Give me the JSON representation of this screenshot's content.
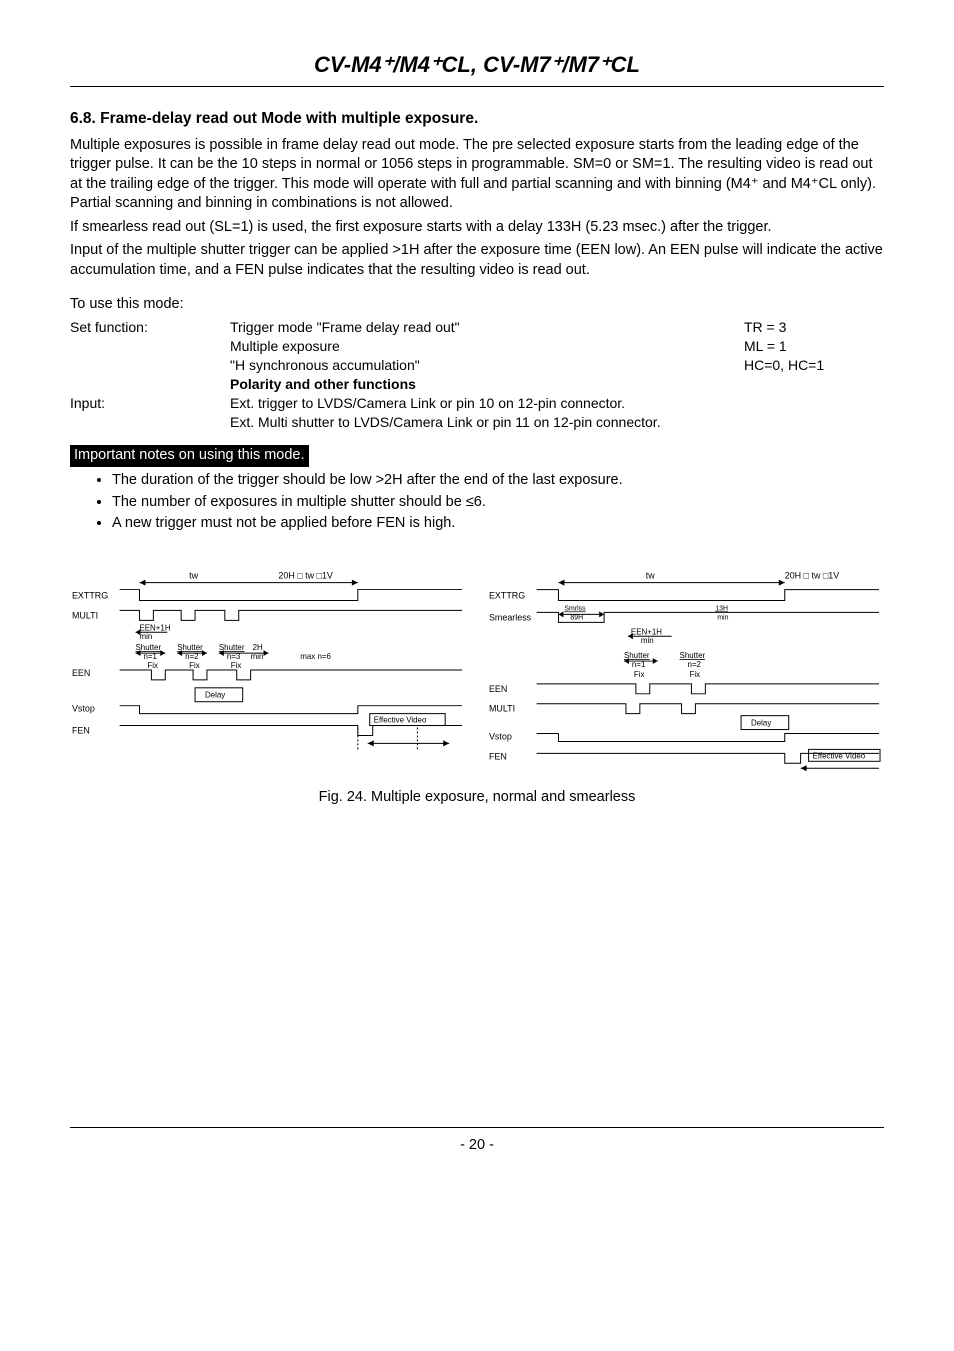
{
  "header": {
    "title": "CV-M4⁺/M4⁺CL, CV-M7⁺/M7⁺CL"
  },
  "section": {
    "heading": "6.8. Frame-delay read out Mode with multiple exposure.",
    "p1": "Multiple exposures is possible in frame delay read out mode. The pre selected exposure starts from the leading edge of the trigger pulse. It can be the 10 steps in normal or 1056 steps in programmable. SM=0 or SM=1. The resulting video is read out at the trailing edge of the trigger. This mode will operate with full and partial scanning and with binning (M4⁺ and M4⁺CL only). Partial scanning and binning in combinations is not allowed.",
    "p2": "If smearless read out (SL=1) is used, the first exposure starts with a delay 133H (5.23 msec.) after the trigger.",
    "p3": "Input of the multiple shutter trigger can be applied >1H after the exposure time (EEN low). An EEN pulse will indicate the active accumulation time, and a FEN pulse indicates that the resulting video is read out."
  },
  "mode": {
    "to_use": "To use this mode:",
    "rows": [
      {
        "label": "Set function:",
        "desc": "Trigger mode \"Frame delay read out\"",
        "val": "TR = 3"
      },
      {
        "label": "",
        "desc": "Multiple exposure",
        "val": "ML = 1"
      },
      {
        "label": "",
        "desc": "\"H synchronous accumulation\"",
        "val": "HC=0, HC=1"
      }
    ],
    "polarity": "Polarity and other functions",
    "input_label": "Input:",
    "input_desc1": "Ext. trigger to LVDS/Camera Link or pin 10 on 12-pin connector.",
    "input_desc2": "Ext. Multi shutter to LVDS/Camera Link or pin 11 on 12-pin connector."
  },
  "notes": {
    "title": "Important notes on using this mode.",
    "items": [
      "The duration of the trigger should be low >2H after the end of the last exposure.",
      "The number of exposures in multiple shutter should be ≤6.",
      "A new trigger must not be applied before FEN is high."
    ]
  },
  "diagram_labels": {
    "left_sidelabels": [
      "EXTTRG",
      "MULTI",
      "EEN",
      "Vstop",
      "FEN"
    ],
    "right_sidelabels": [
      "EXTTRG",
      "Smearless",
      "EEN",
      "MULTI",
      "Vstop",
      "FEN"
    ],
    "tw": "tw",
    "range": "20H □ tw □1V",
    "een1h": "EEN+1H",
    "min": "min",
    "shutter": "Shutter",
    "n1": "n=1",
    "n2": "n=2",
    "n3": "n=3",
    "fix": "Fix",
    "_2h": "2H",
    "maxn6": "max n=6",
    "delay": "Delay",
    "eff": "Effective Video",
    "smrlss": "Smrlss",
    "_89h": "89H",
    "_13h": "13H"
  },
  "fig_caption": "Fig. 24. Multiple exposure, normal and smearless",
  "page_num": "- 20 -"
}
